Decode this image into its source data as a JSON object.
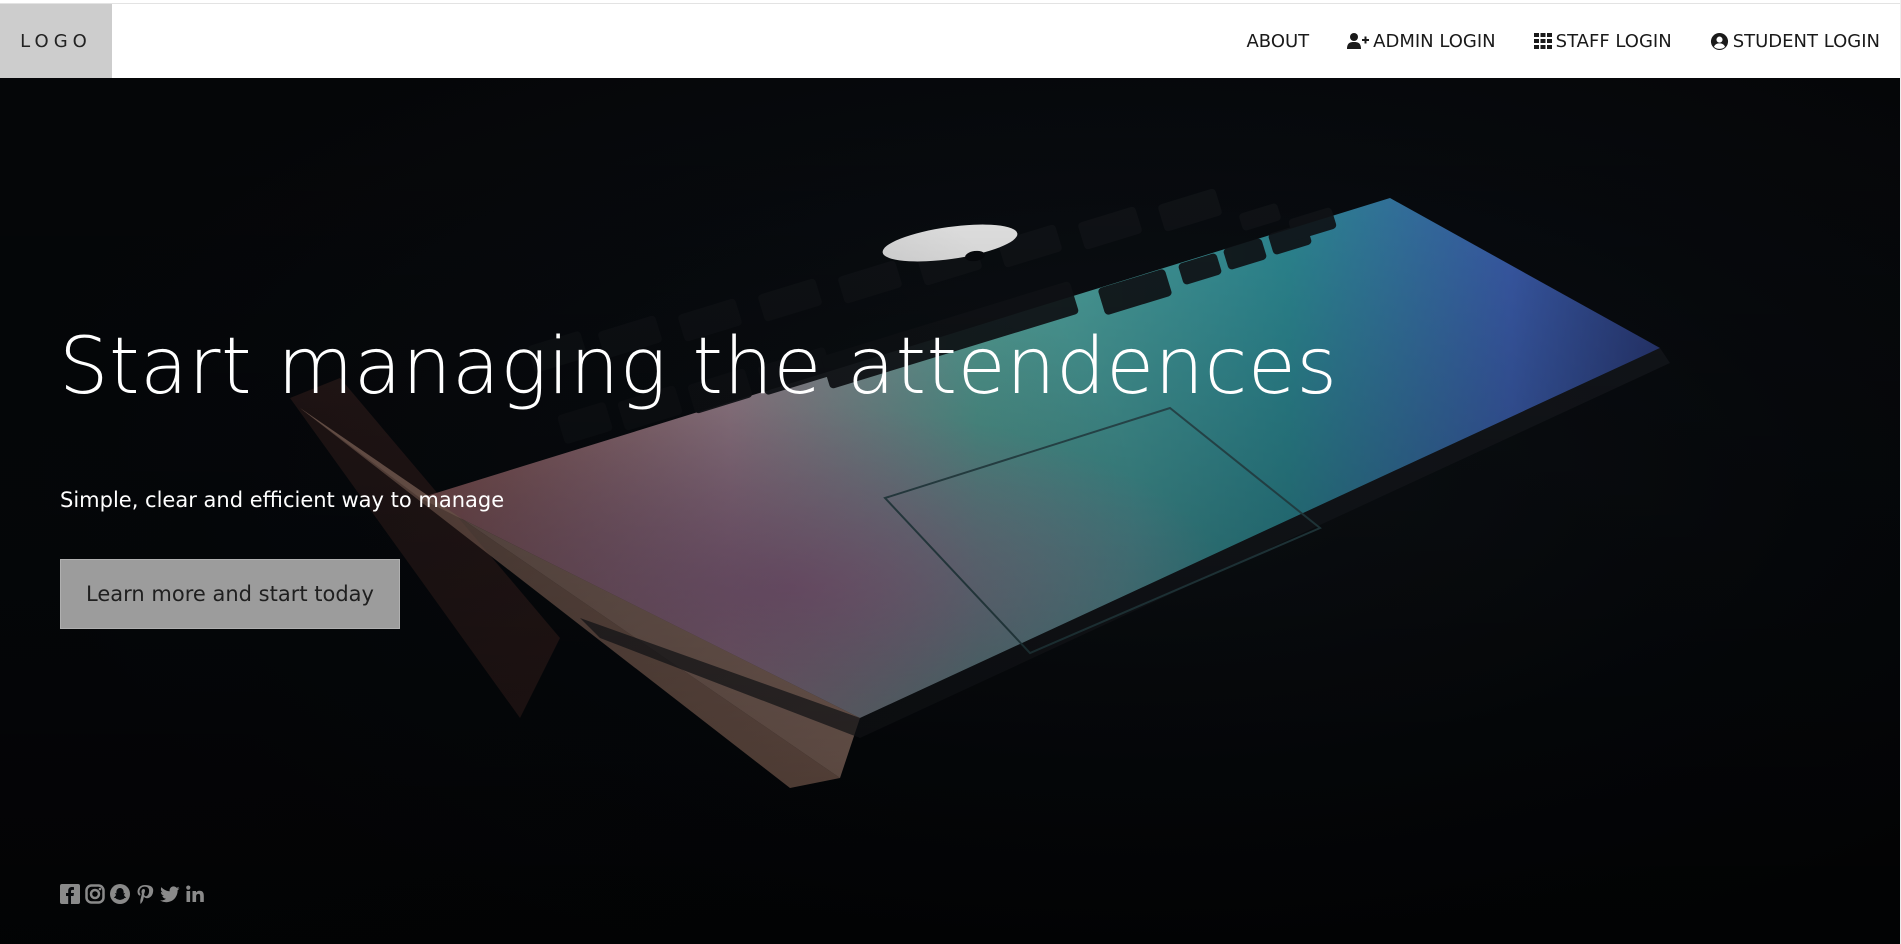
{
  "header": {
    "logo": "LOGO",
    "nav": [
      {
        "label": "ABOUT",
        "icon": "none"
      },
      {
        "label": "ADMIN LOGIN",
        "icon": "user-plus-icon"
      },
      {
        "label": "STAFF LOGIN",
        "icon": "grid-icon"
      },
      {
        "label": "STUDENT LOGIN",
        "icon": "user-circle-icon"
      }
    ]
  },
  "hero": {
    "headline": "Start managing the attendences",
    "subline": "Simple, clear and efficient way to manage",
    "cta": "Learn more and start today",
    "background": "laptop-photo"
  },
  "social": [
    "facebook-icon",
    "instagram-icon",
    "snapchat-icon",
    "pinterest-icon",
    "twitter-icon",
    "linkedin-icon"
  ],
  "colors": {
    "logo_bg": "#cdcdcd",
    "hero_bg": "#07090c",
    "cta_bg": "#9c9c9c",
    "icon_color": "#8a8a8a"
  }
}
